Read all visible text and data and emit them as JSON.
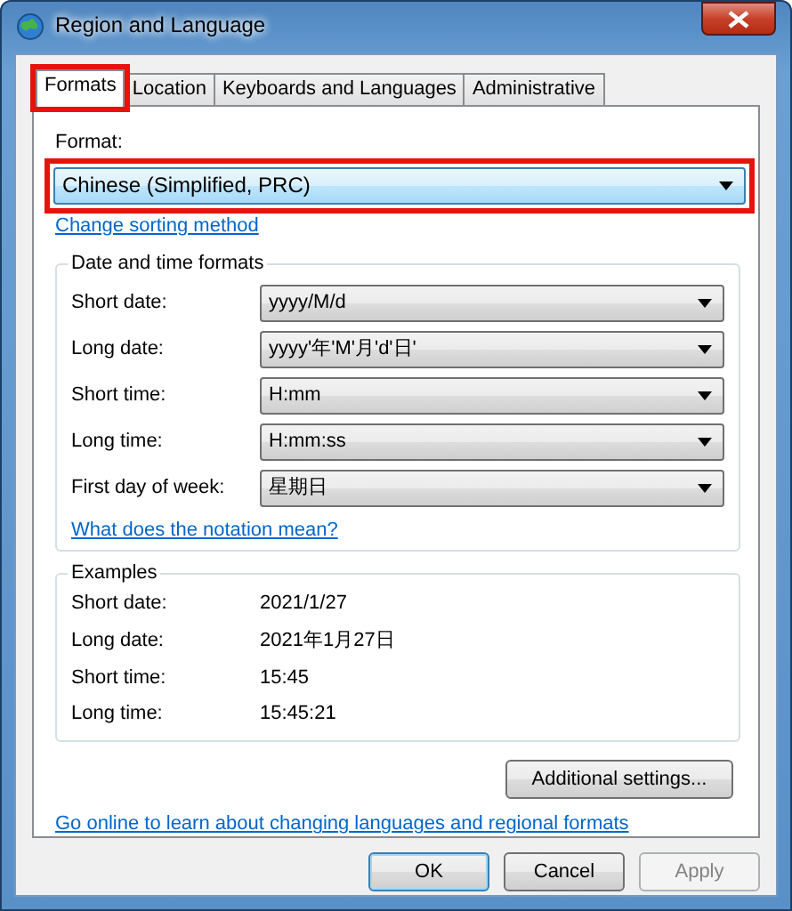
{
  "window": {
    "title": "Region and Language"
  },
  "tabs": [
    {
      "label": "Formats",
      "selected": true,
      "highlighted": true
    },
    {
      "label": "Location",
      "selected": false,
      "highlighted": false
    },
    {
      "label": "Keyboards and Languages",
      "selected": false,
      "highlighted": false
    },
    {
      "label": "Administrative",
      "selected": false,
      "highlighted": false
    }
  ],
  "format": {
    "label": "Format:",
    "value": "Chinese (Simplified, PRC)",
    "highlighted": true
  },
  "sorting_link": "Change sorting method",
  "date_time_formats": {
    "title": "Date and time formats",
    "rows": [
      {
        "label": "Short date:",
        "value": "yyyy/M/d"
      },
      {
        "label": "Long date:",
        "value": "yyyy'年'M'月'd'日'"
      },
      {
        "label": "Short time:",
        "value": "H:mm"
      },
      {
        "label": "Long time:",
        "value": "H:mm:ss"
      },
      {
        "label": "First day of week:",
        "value": "星期日"
      }
    ],
    "link": "What does the notation mean?"
  },
  "examples": {
    "title": "Examples",
    "rows": [
      {
        "label": "Short date:",
        "value": "2021/1/27"
      },
      {
        "label": "Long date:",
        "value": "2021年1月27日"
      },
      {
        "label": "Short time:",
        "value": "15:45"
      },
      {
        "label": "Long time:",
        "value": "15:45:21"
      }
    ]
  },
  "additional_settings_button": "Additional settings...",
  "online_link": "Go online to learn about changing languages and regional formats",
  "buttons": [
    {
      "label": "OK",
      "default": true,
      "disabled": false
    },
    {
      "label": "Cancel",
      "default": false,
      "disabled": false
    },
    {
      "label": "Apply",
      "default": false,
      "disabled": true
    }
  ]
}
